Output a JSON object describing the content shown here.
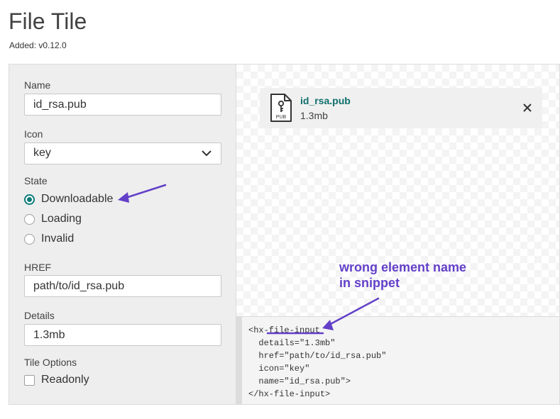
{
  "page": {
    "title": "File Tile",
    "subtitle": "Added: v0.12.0"
  },
  "form": {
    "name": {
      "label": "Name",
      "value": "id_rsa.pub"
    },
    "icon": {
      "label": "Icon",
      "value": "key"
    },
    "state": {
      "label": "State",
      "options": [
        {
          "label": "Downloadable",
          "checked": true
        },
        {
          "label": "Loading",
          "checked": false
        },
        {
          "label": "Invalid",
          "checked": false
        }
      ]
    },
    "href": {
      "label": "HREF",
      "value": "path/to/id_rsa.pub"
    },
    "details": {
      "label": "Details",
      "value": "1.3mb"
    },
    "tile_options": {
      "label": "Tile Options",
      "readonly": {
        "label": "Readonly",
        "checked": false
      }
    }
  },
  "preview": {
    "file_name": "id_rsa.pub",
    "file_details": "1.3mb",
    "icon_name": "key-file-icon",
    "icon_caption": "PUB"
  },
  "snippet": {
    "lines": [
      "<hx-file-input",
      "  details=\"1.3mb\"",
      "  href=\"path/to/id_rsa.pub\"",
      "  icon=\"key\"",
      "  name=\"id_rsa.pub\">",
      "</hx-file-input>"
    ]
  },
  "annotation": {
    "line1": "wrong element name",
    "line2": "in snippet"
  },
  "colors": {
    "accent": "#0e7c7b",
    "link": "#0e6e6d",
    "annotation": "#6340c9",
    "sidebar_bg": "#eeeeee"
  }
}
